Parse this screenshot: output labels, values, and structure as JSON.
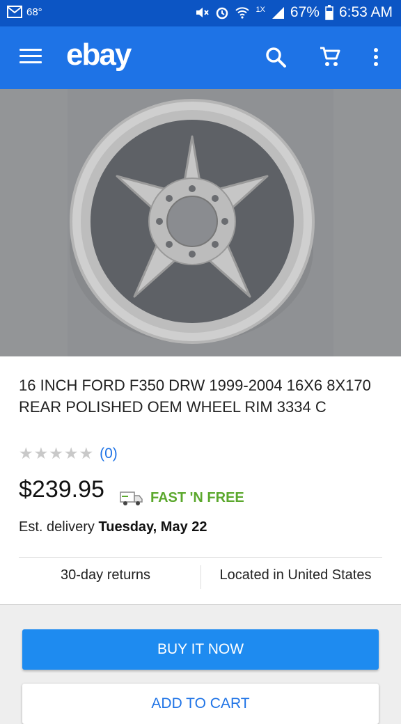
{
  "status_bar": {
    "temperature": "68°",
    "network": "1X",
    "battery": "67%",
    "time": "6:53 AM"
  },
  "app_bar": {
    "logo": "ebay"
  },
  "listing": {
    "title": "16 INCH FORD F350 DRW 1999-2004 16X6 8X170 REAR POLISHED OEM WHEEL RIM 3334 C",
    "stars": "★★★★★",
    "review_count": "(0)",
    "price": "$239.95",
    "shipping": "FAST 'N FREE",
    "delivery_prefix": "Est. delivery",
    "delivery_date": "Tuesday, May 22",
    "returns": "30-day returns",
    "location": "Located in United States"
  },
  "actions": {
    "buy_now": "BUY IT NOW",
    "add_to_cart": "ADD TO CART"
  },
  "colors": {
    "app_bar": "#1e73e6",
    "status_bar": "#0c55c4",
    "shipping": "#5ba82d",
    "link": "#1e73e6"
  }
}
